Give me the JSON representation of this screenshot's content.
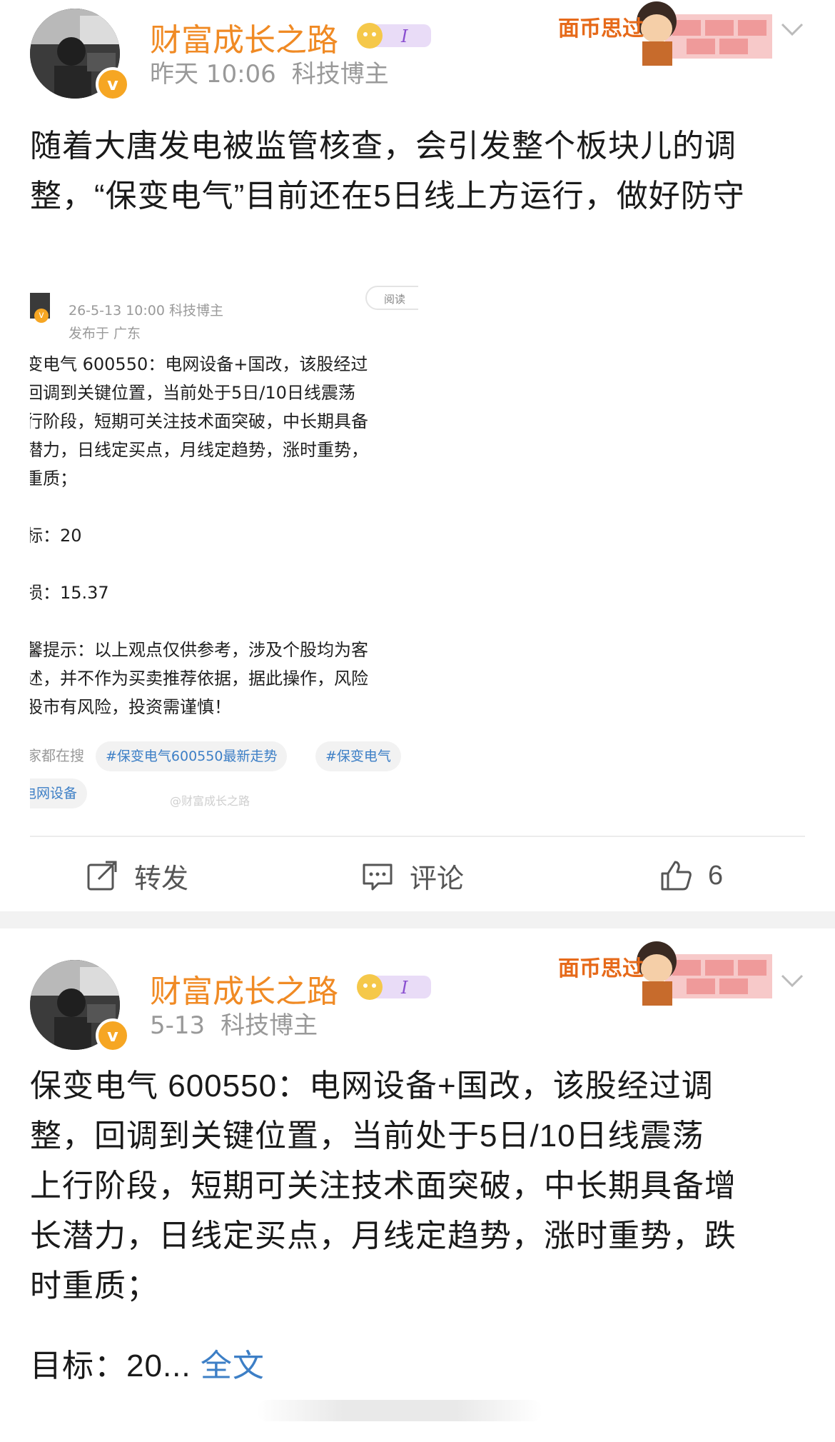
{
  "posts": [
    {
      "username": "财富成长之路",
      "timestamp": "昨天 10:06",
      "tag": "科技博主",
      "avatar_badge": "v",
      "level": "I",
      "deco_text": "面币思过",
      "text": "随着大唐发电被监管核查，会引发整个板块儿的调整，“保变电气”目前还在5日线上方运行，做好防守",
      "embed": {
        "meta": "26-5-13 10:00  科技博主",
        "location": "发布于 广东",
        "read_label": "阅读",
        "lines": [
          "变电气 600550：电网设备+国改，该股经过",
          "回调到关键位置，当前处于5日/10日线震荡",
          "行阶段，短期可关注技术面突破，中长期具备",
          "潜力，日线定买点，月线定趋势，涨时重势，",
          "重质；",
          "标：20",
          "损：15.37",
          "馨提示：以上观点仅供参考，涉及个股均为客",
          "述，并不作为买卖推荐依据，据此操作，风险",
          "股市有风险，投资需谨慎！"
        ],
        "tags_prefix": "家都在搜",
        "tags": [
          "#保变电气600550最新走势",
          "#保变电气",
          "电网设备"
        ],
        "watermark": "@财富成长之路"
      },
      "actions": {
        "repost": "转发",
        "comment": "评论",
        "like_count": "6"
      }
    },
    {
      "username": "财富成长之路",
      "timestamp": "5-13",
      "tag": "科技博主",
      "avatar_badge": "v",
      "level": "I",
      "deco_text": "面币思过",
      "text_lines": [
        "保变电气 600550：电网设备+国改，该股经过调",
        "整，回调到关键位置，当前处于5日/10日线震荡",
        "上行阶段，短期可关注技术面突破，中长期具备增",
        "长潜力，日线定买点，月线定趋势，涨时重势，跌",
        "时重质；"
      ],
      "target_text": "目标：20...",
      "full_text_link": "全文"
    }
  ],
  "colors": {
    "username": "#f08a24",
    "link": "#3d7fc6",
    "meta": "#999999",
    "badge": "#f6a623"
  }
}
